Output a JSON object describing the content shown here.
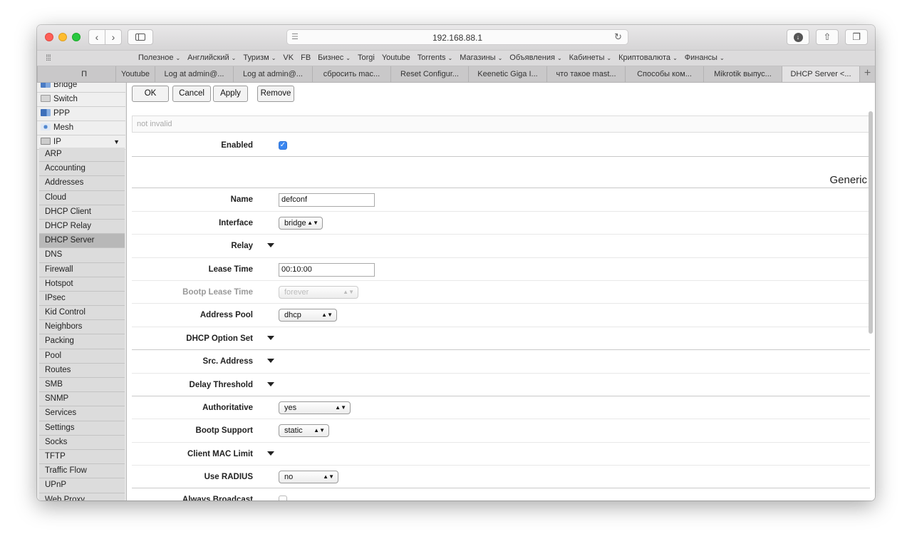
{
  "browser": {
    "url": "192.168.88.1",
    "favorites": [
      {
        "label": "Полезное",
        "menu": true
      },
      {
        "label": "Английский",
        "menu": true
      },
      {
        "label": "Туризм",
        "menu": true
      },
      {
        "label": "VK",
        "menu": false
      },
      {
        "label": "FB",
        "menu": false
      },
      {
        "label": "Бизнес",
        "menu": true
      },
      {
        "label": "Torgi",
        "menu": false
      },
      {
        "label": "Youtube",
        "menu": false
      },
      {
        "label": "Torrents",
        "menu": true
      },
      {
        "label": "Магазины",
        "menu": true
      },
      {
        "label": "Объявления",
        "menu": true
      },
      {
        "label": "Кабинеты",
        "menu": true
      },
      {
        "label": "Криптовалюта",
        "menu": true
      },
      {
        "label": "Финансы",
        "menu": true
      }
    ],
    "tabs": [
      "П",
      "Youtube",
      "Log at admin@...",
      "Log at admin@...",
      "сбросить mac...",
      "Reset Configur...",
      "Keenetic Giga I...",
      "что такое mast...",
      "Способы ком...",
      "Mikrotik выпус...",
      "DHCP Server <..."
    ],
    "tab_plus": "+"
  },
  "sidebar": {
    "top_items": [
      {
        "label": "Bridge",
        "icon": "bridge-icon"
      },
      {
        "label": "Switch",
        "icon": "switch-icon"
      },
      {
        "label": "PPP",
        "icon": "ppp-icon"
      },
      {
        "label": "Mesh",
        "icon": "mesh-icon"
      },
      {
        "label": "IP",
        "icon": "ip-icon"
      }
    ],
    "ip_arrow": "▼",
    "ip_submenu": [
      "ARP",
      "Accounting",
      "Addresses",
      "Cloud",
      "DHCP Client",
      "DHCP Relay",
      "DHCP Server",
      "DNS",
      "Firewall",
      "Hotspot",
      "IPsec",
      "Kid Control",
      "Neighbors",
      "Packing",
      "Pool",
      "Routes",
      "SMB",
      "SNMP",
      "Services",
      "Settings",
      "Socks",
      "TFTP",
      "Traffic Flow",
      "UPnP",
      "Web Proxy"
    ],
    "active_item": "DHCP Server"
  },
  "form": {
    "buttons": {
      "ok": "OK",
      "cancel": "Cancel",
      "apply": "Apply",
      "remove": "Remove"
    },
    "status": "not invalid",
    "section_title": "Generic",
    "fields": {
      "enabled": {
        "label": "Enabled",
        "checked": true
      },
      "name": {
        "label": "Name",
        "value": "defconf"
      },
      "interface": {
        "label": "Interface",
        "value": "bridge"
      },
      "relay": {
        "label": "Relay"
      },
      "lease_time": {
        "label": "Lease Time",
        "value": "00:10:00"
      },
      "bootp_lease_time": {
        "label": "Bootp Lease Time",
        "value": "forever"
      },
      "address_pool": {
        "label": "Address Pool",
        "value": "dhcp"
      },
      "dhcp_option_set": {
        "label": "DHCP Option Set"
      },
      "src_address": {
        "label": "Src. Address"
      },
      "delay_threshold": {
        "label": "Delay Threshold"
      },
      "authoritative": {
        "label": "Authoritative",
        "value": "yes"
      },
      "bootp_support": {
        "label": "Bootp Support",
        "value": "static"
      },
      "client_mac_limit": {
        "label": "Client MAC Limit"
      },
      "use_radius": {
        "label": "Use RADIUS",
        "value": "no"
      },
      "always_broadcast": {
        "label": "Always Broadcast",
        "checked": false
      }
    }
  },
  "colors": {
    "accent": "#3a86f0",
    "active_menu": "#b8b8b8"
  }
}
